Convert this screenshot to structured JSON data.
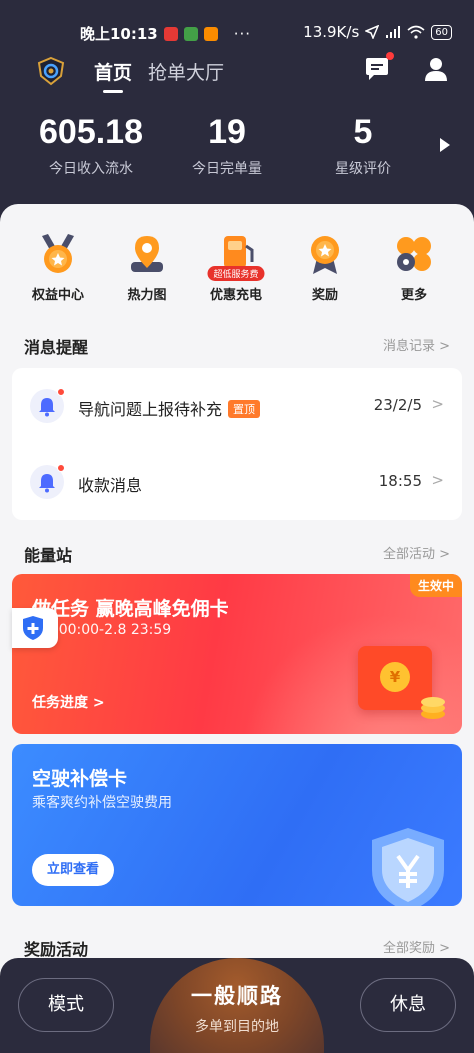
{
  "status_bar": {
    "time": "晚上10:13",
    "more": "···",
    "net_speed": "13.9K/s",
    "battery": "60"
  },
  "topnav": {
    "tabs": [
      {
        "label": "首页",
        "active": true
      },
      {
        "label": "抢单大厅",
        "active": false
      }
    ]
  },
  "stats": [
    {
      "value": "605.18",
      "label": "今日收入流水"
    },
    {
      "value": "19",
      "label": "今日完单量"
    },
    {
      "value": "5",
      "label": "星级评价"
    }
  ],
  "quick_actions": [
    {
      "label": "权益中心",
      "icon": "medal-icon"
    },
    {
      "label": "热力图",
      "icon": "map-pin-icon"
    },
    {
      "label": "优惠充电",
      "icon": "charging-station-icon",
      "badge": "超低服务费"
    },
    {
      "label": "奖励",
      "icon": "award-icon"
    },
    {
      "label": "更多",
      "icon": "more-apps-icon"
    }
  ],
  "messages": {
    "title": "消息提醒",
    "link": "消息记录 >",
    "items": [
      {
        "text": "导航问题上报待补充",
        "badge": "置顶",
        "time": "23/2/5"
      },
      {
        "text": "收款消息",
        "badge": "",
        "time": "18:55"
      }
    ]
  },
  "energy": {
    "title": "能量站",
    "link": "全部活动 >",
    "task_card": {
      "status": "生效中",
      "title": "做任务 赢晚高峰免佣卡",
      "subtitle": "2.6 00:00-2.8 23:59",
      "cta": "任务进度 >",
      "coin_symbol": "¥"
    },
    "compensation_card": {
      "title": "空驶补偿卡",
      "subtitle": "乘客爽约补偿空驶费用",
      "button": "立即查看"
    }
  },
  "rewards": {
    "title": "奖励活动",
    "link": "全部奖励 >"
  },
  "dock": {
    "left": "模式",
    "center_title": "一般顺路",
    "center_sub": "多单到目的地",
    "right": "休息"
  },
  "colors": {
    "header_bg": "#2b2b3d",
    "accent_orange": "#ff8a1e",
    "promo_red": "#ff3a45",
    "promo_blue": "#2f6ef5"
  }
}
